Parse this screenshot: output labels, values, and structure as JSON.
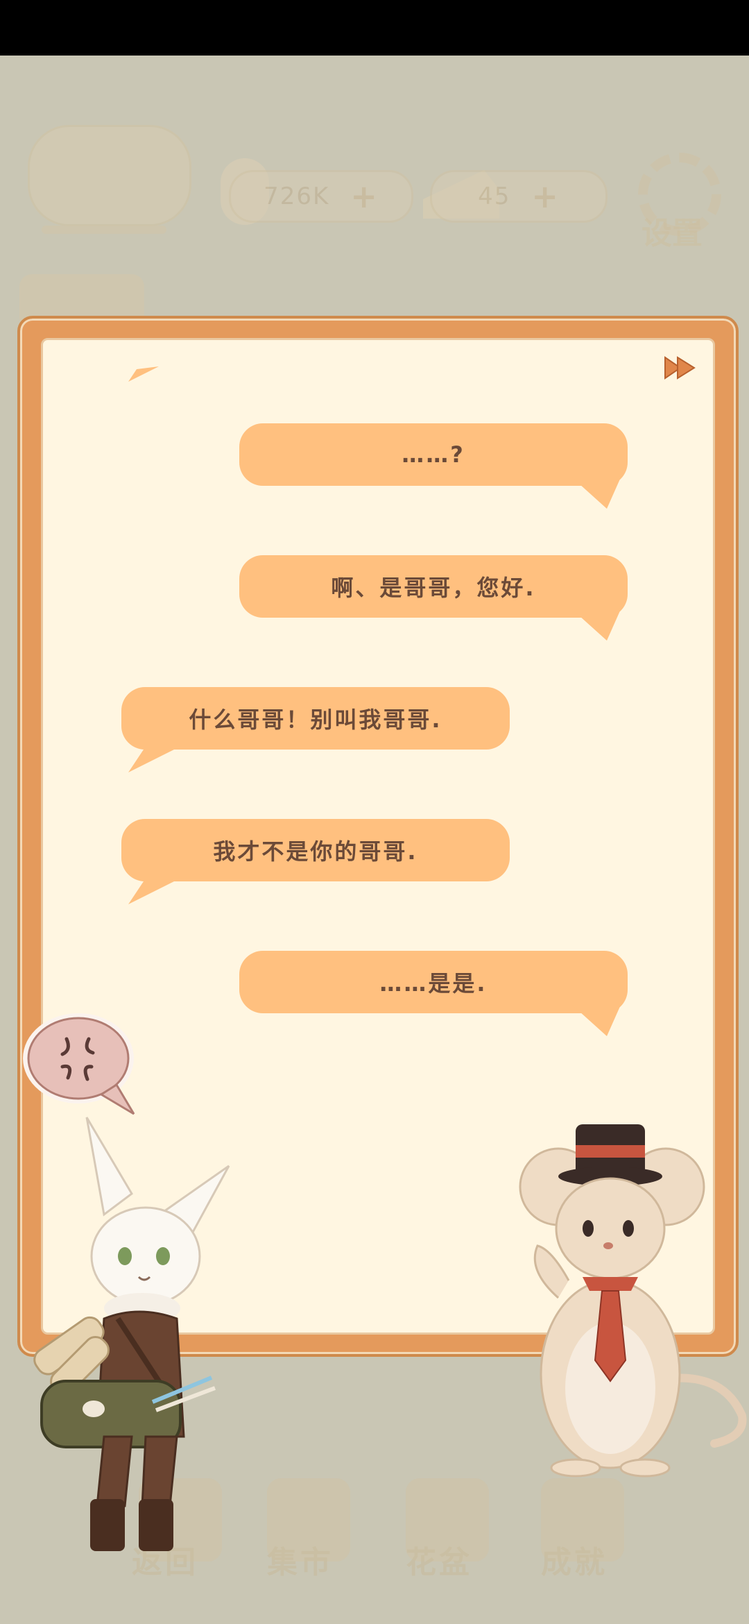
{
  "hud": {
    "fish_amount": "726K",
    "cake_amount": "45",
    "settings_label": "设置",
    "bottom_nav": [
      "返回",
      "集市",
      "花盆",
      "成就"
    ]
  },
  "dialogue": {
    "lines": [
      {
        "text": "……?",
        "side": "right"
      },
      {
        "text": "啊、是哥哥，您好.",
        "side": "right"
      },
      {
        "text": "什么哥哥！别叫我哥哥.",
        "side": "left"
      },
      {
        "text": "我才不是你的哥哥.",
        "side": "left"
      },
      {
        "text": "……是是.",
        "side": "right"
      }
    ]
  },
  "icons": {
    "fast_forward": "fast-forward-icon",
    "anger": "anger-mark-icon"
  },
  "colors": {
    "bubble": "#ffc07f",
    "frame": "#e49a5c",
    "paper": "#fff6e1",
    "text": "#6b4a38"
  }
}
